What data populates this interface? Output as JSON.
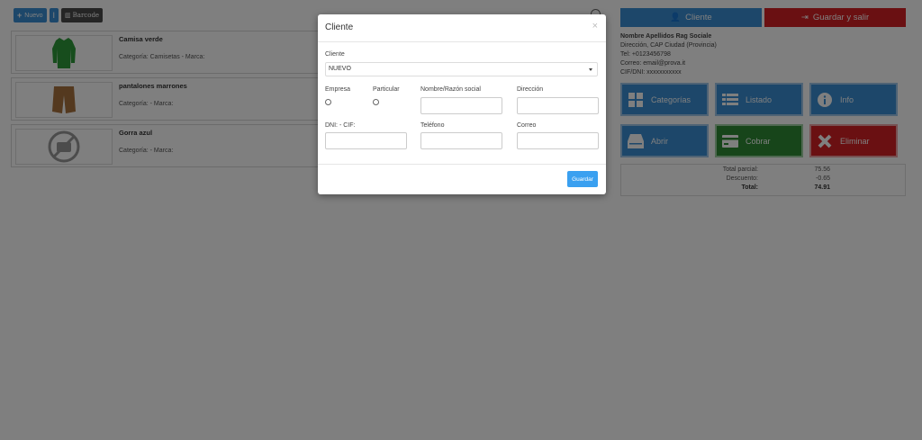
{
  "toolbar": {
    "new_label": "Nuevo",
    "barcode_label": "Barcode"
  },
  "products": [
    {
      "name": "Camisa verde",
      "category": "Categoría: Camisetas - Marca:"
    },
    {
      "name": "pantalones marrones",
      "category": "Categoría: - Marca:"
    },
    {
      "name": "Gorra azul",
      "category": "Categoría: - Marca:"
    }
  ],
  "right": {
    "client_label": "Cliente",
    "save_exit_label": "Guardar y salir",
    "client_info": {
      "name": "Nombre Apellidos Rag Sociale",
      "address": "Dirección, CAP Ciudad (Provincia)",
      "phone": "Tel: +0123456798",
      "email": "Correo: email@prova.it",
      "cif": "CIF/DNI: xxxxxxxxxxx"
    },
    "tiles": [
      {
        "label": "Categorías",
        "icon": "grid-icon",
        "color": "#3b8fd4"
      },
      {
        "label": "Listado",
        "icon": "list-icon",
        "color": "#3b8fd4"
      },
      {
        "label": "Info",
        "icon": "info-icon",
        "color": "#3b8fd4"
      },
      {
        "label": "Abrir",
        "icon": "drawer-icon",
        "color": "#3b8fd4"
      },
      {
        "label": "Cobrar",
        "icon": "credit-card-icon",
        "color": "#2e8b35"
      },
      {
        "label": "Eliminar",
        "icon": "close-icon",
        "color": "#d52124"
      }
    ],
    "totals": {
      "subtotal_label": "Total parcial:",
      "subtotal_value": "75.56",
      "discount_label": "Descuento:",
      "discount_value": "-0.65",
      "total_label": "Total:",
      "total_value": "74.91"
    }
  },
  "modal": {
    "title": "Cliente",
    "close": "×",
    "cliente_label": "Cliente",
    "cliente_value": "NUEVO",
    "empresa_label": "Empresa",
    "particular_label": "Particular",
    "nombre_label": "Nombre/Razón social",
    "direccion_label": "Dirección",
    "dni_label": "DNI: - CIF:",
    "telefono_label": "Teléfono",
    "correo_label": "Correo",
    "save_label": "Guardar"
  }
}
